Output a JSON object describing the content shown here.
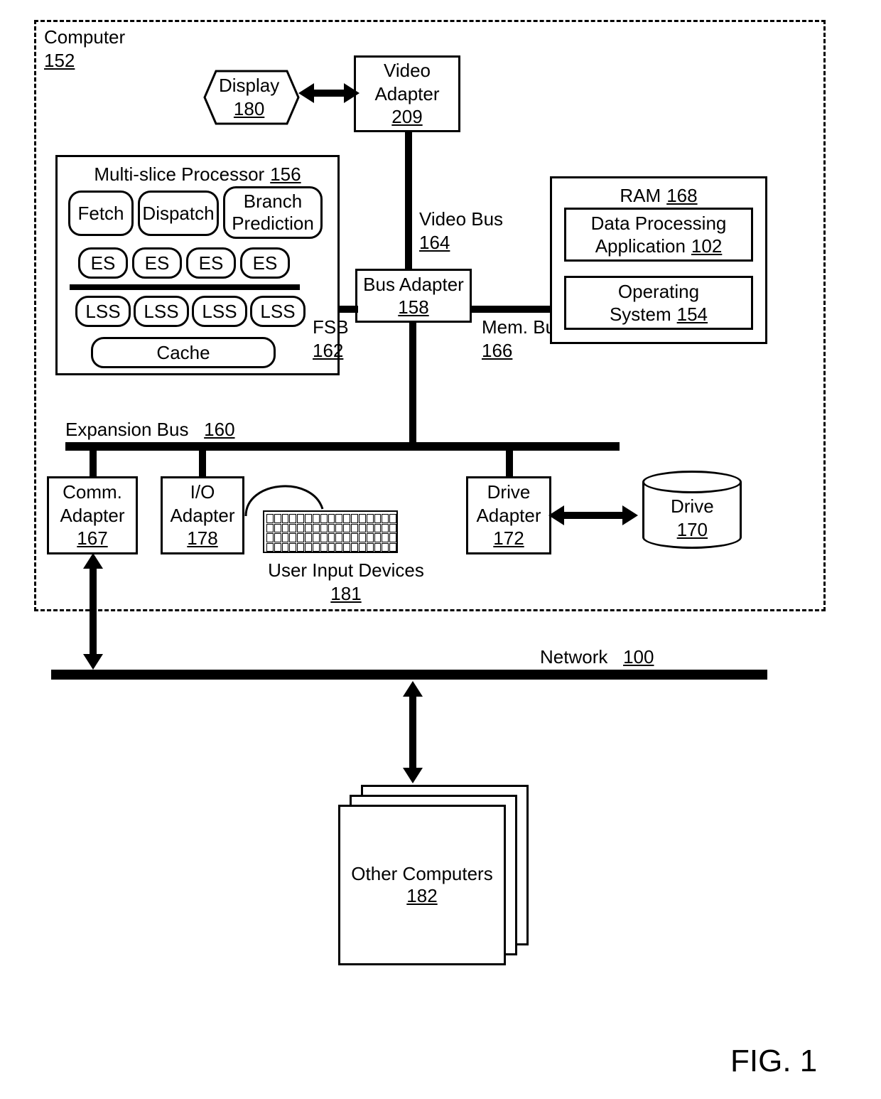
{
  "computer": {
    "label": "Computer",
    "ref": "152"
  },
  "display": {
    "label": "Display",
    "ref": "180"
  },
  "videoAdapter": {
    "label1": "Video",
    "label2": "Adapter",
    "ref": "209"
  },
  "processor": {
    "title": "Multi-slice Processor",
    "ref": "156",
    "fetch": "Fetch",
    "dispatch": "Dispatch",
    "branch1": "Branch",
    "branch2": "Prediction",
    "es": "ES",
    "lss": "LSS",
    "cache": "Cache"
  },
  "busAdapter": {
    "label": "Bus Adapter",
    "ref": "158"
  },
  "fsb": {
    "label": "FSB",
    "ref": "162"
  },
  "videoBus": {
    "label": "Video Bus",
    "ref": "164"
  },
  "memBus": {
    "label": "Mem. Bus",
    "ref": "166"
  },
  "ram": {
    "label": "RAM",
    "ref": "168",
    "app1": "Data Processing",
    "app2": "Application",
    "appRef": "102",
    "os1": "Operating",
    "os2": "System",
    "osRef": "154"
  },
  "expBus": {
    "label": "Expansion Bus",
    "ref": "160"
  },
  "comm": {
    "label1": "Comm.",
    "label2": "Adapter",
    "ref": "167"
  },
  "io": {
    "label1": "I/O",
    "label2": "Adapter",
    "ref": "178"
  },
  "userInput": {
    "label": "User Input Devices",
    "ref": "181"
  },
  "driveAdapter": {
    "label1": "Drive",
    "label2": "Adapter",
    "ref": "172"
  },
  "drive": {
    "label": "Drive",
    "ref": "170"
  },
  "network": {
    "label": "Network",
    "ref": "100"
  },
  "otherComputers": {
    "label": "Other Computers",
    "ref": "182"
  },
  "figure": "FIG. 1"
}
